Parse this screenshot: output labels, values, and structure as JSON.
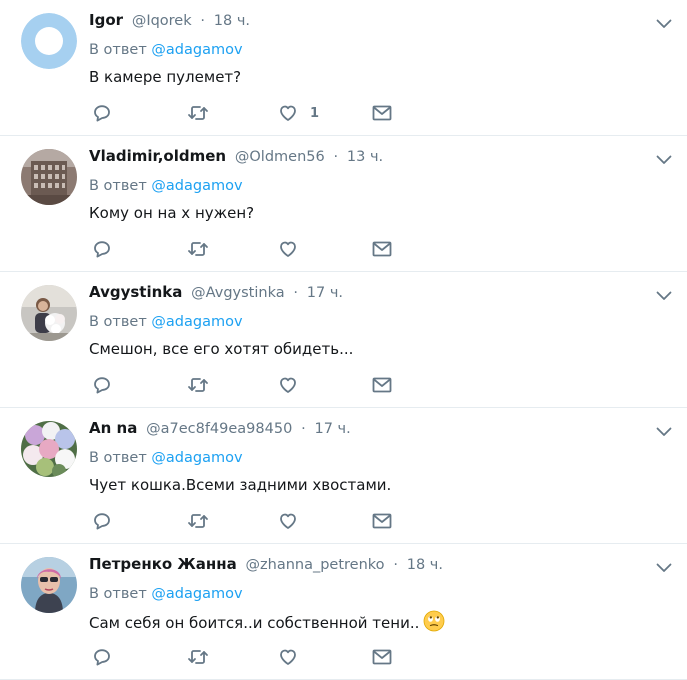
{
  "tweets": [
    {
      "name": "Igor",
      "handle": "@Iqorek",
      "dot": "·",
      "time": "18 ч.",
      "reply_prefix": "В ответ",
      "reply_to": "@adagamov",
      "text": "В камере пулемет?",
      "like_count": "1",
      "avatar": "default-circle-avatar"
    },
    {
      "name": "Vladimir,oldmen",
      "handle": "@Oldmen56",
      "dot": "·",
      "time": "13 ч.",
      "reply_prefix": "В ответ",
      "reply_to": "@adagamov",
      "text": "Кому он на х нужен?",
      "like_count": "",
      "avatar": "building-photo-avatar"
    },
    {
      "name": "Avgystinka",
      "handle": "@Avgystinka",
      "dot": "·",
      "time": "17 ч.",
      "reply_prefix": "В ответ",
      "reply_to": "@adagamov",
      "text": "Смешон, все его хотят обидеть...",
      "like_count": "",
      "avatar": "flowers-person-avatar"
    },
    {
      "name": "An na",
      "handle": "@a7ec8f49ea98450",
      "dot": "·",
      "time": "17 ч.",
      "reply_prefix": "В ответ",
      "reply_to": "@adagamov",
      "text": "Чует кошка.Всеми задними хвостами.",
      "like_count": "",
      "avatar": "flower-bouquet-avatar"
    },
    {
      "name": "Петренко Жанна",
      "handle": "@zhanna_petrenko",
      "dot": "·",
      "time": "18 ч.",
      "reply_prefix": "В ответ",
      "reply_to": "@adagamov",
      "text": "Сам себя он боится..и собственной тени..",
      "like_count": "",
      "avatar": "woman-photo-avatar",
      "emoji": "eye-roll-emoji"
    }
  ],
  "colors": {
    "accent": "#1da1f2",
    "secondary_text": "#657786",
    "icon": "#657786",
    "divider": "#e6ecf0"
  }
}
